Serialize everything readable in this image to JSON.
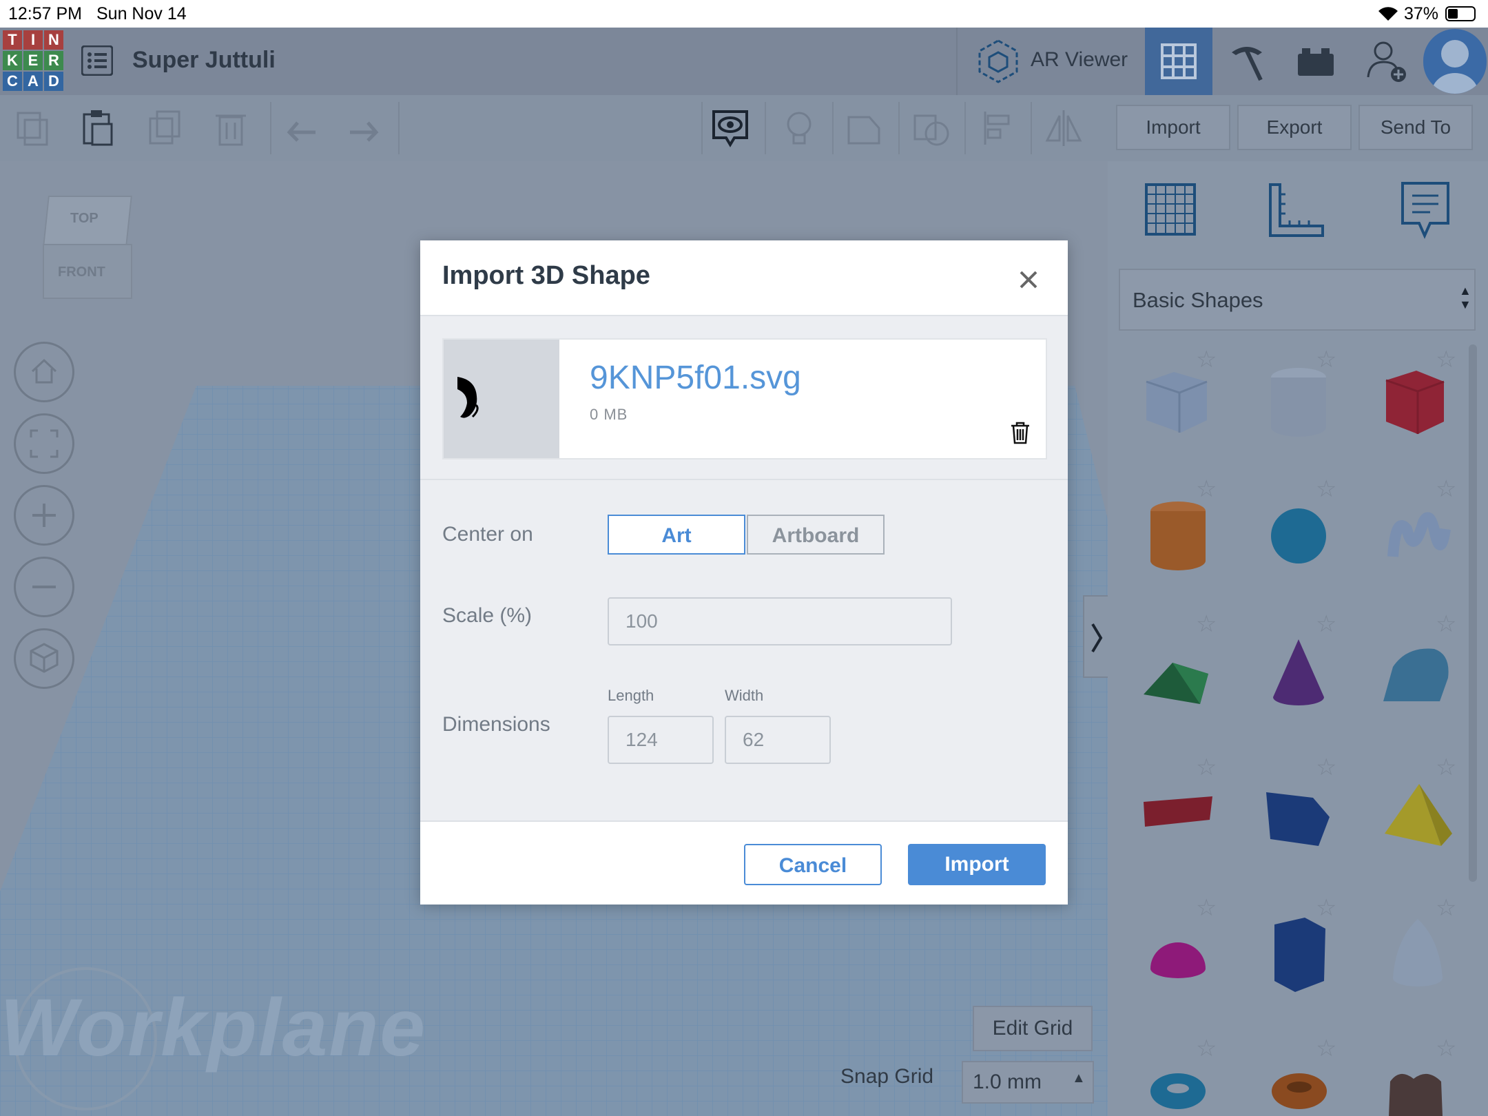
{
  "status_bar": {
    "time": "12:57 PM",
    "date": "Sun Nov 14",
    "battery": "37%"
  },
  "app": {
    "logo_letters": [
      "T",
      "I",
      "N",
      "K",
      "E",
      "R",
      "C",
      "A",
      "D"
    ],
    "project_name": "Super Juttuli",
    "ar_viewer_label": "AR Viewer"
  },
  "toolbar": {
    "import_label": "Import",
    "export_label": "Export",
    "send_to_label": "Send To"
  },
  "view_cube": {
    "top": "TOP",
    "front": "FRONT"
  },
  "workplane": {
    "watermark": "Workplane",
    "edit_grid_label": "Edit Grid",
    "snap_grid_label": "Snap Grid",
    "snap_grid_value": "1.0 mm"
  },
  "shapes_panel": {
    "category": "Basic Shapes",
    "shapes": [
      "box",
      "cylinder",
      "box-red",
      "cylinder-orange",
      "sphere",
      "scribble",
      "roof",
      "cone",
      "round-roof",
      "text",
      "polygon",
      "pyramid",
      "half-sphere",
      "hexagonal-prism",
      "paraboloid",
      "torus",
      "tube",
      "heart"
    ]
  },
  "dialog": {
    "title": "Import 3D Shape",
    "file_name": "9KNP5f01.svg",
    "file_size": "0 MB",
    "center_on_label": "Center on",
    "center_options": [
      "Art",
      "Artboard"
    ],
    "center_selected": "Art",
    "scale_label": "Scale (%)",
    "scale_value": "100",
    "dimensions_label": "Dimensions",
    "length_label": "Length",
    "length_value": "124",
    "width_label": "Width",
    "width_value": "62",
    "cancel_label": "Cancel",
    "import_label": "Import"
  },
  "colors": {
    "accent": "#4a8bd6",
    "overlay": "#8793a4",
    "red": "#8f2436",
    "orange": "#9a5a2a",
    "blue_sphere": "#1e6a93"
  }
}
